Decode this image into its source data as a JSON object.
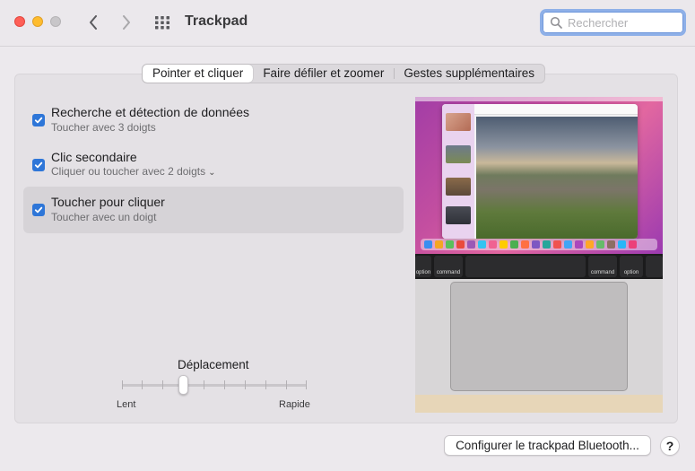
{
  "window": {
    "title": "Trackpad",
    "search_placeholder": "Rechercher"
  },
  "tabs": [
    {
      "label": "Pointer et cliquer",
      "active": true
    },
    {
      "label": "Faire défiler et zoomer",
      "active": false
    },
    {
      "label": "Gestes supplémentaires",
      "active": false
    }
  ],
  "options": [
    {
      "title": "Recherche et détection de données",
      "subtitle": "Toucher avec 3 doigts",
      "checked": true,
      "selected": false
    },
    {
      "title": "Clic secondaire",
      "subtitle": "Cliquer ou toucher avec 2 doigts",
      "checked": true,
      "selected": false,
      "has_dropdown": true
    },
    {
      "title": "Toucher pour cliquer",
      "subtitle": "Toucher avec un doigt",
      "checked": true,
      "selected": true
    }
  ],
  "tracking_speed": {
    "label": "Déplacement",
    "min_label": "Lent",
    "max_label": "Rapide",
    "value_fraction": 0.33
  },
  "footer": {
    "bluetooth_button": "Configurer le trackpad Bluetooth...",
    "help_button": "?"
  },
  "preview": {
    "keys": [
      "option",
      "command",
      "command",
      "option"
    ]
  },
  "colors": {
    "accent": "#2e76d8",
    "close": "#fe5f57",
    "minimize": "#febc2e"
  }
}
